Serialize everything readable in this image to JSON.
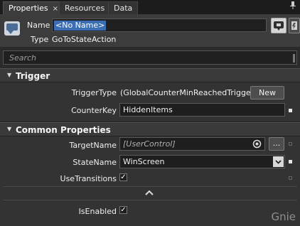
{
  "tabs": [
    {
      "label": "Properties",
      "close": "×"
    },
    {
      "label": "Resources"
    },
    {
      "label": "Data"
    }
  ],
  "header": {
    "name_label": "Name",
    "name_value": "<No Name>",
    "type_label": "Type",
    "type_value": "GoToStateAction"
  },
  "search": {
    "placeholder": "Search"
  },
  "trigger": {
    "title": "Trigger",
    "trigger_type_label": "TriggerType",
    "trigger_type_value": "(GlobalCounterMinReachedTrigger)",
    "new_label": "New",
    "counter_key_label": "CounterKey",
    "counter_key_value": "HiddenItems"
  },
  "common": {
    "title": "Common Properties",
    "target_name_label": "TargetName",
    "target_name_value": "[UserControl]",
    "browse_label": "...",
    "state_name_label": "StateName",
    "state_name_value": "WinScreen",
    "use_transitions_label": "UseTransitions",
    "use_transitions_checked": "✓",
    "is_enabled_label": "IsEnabled",
    "is_enabled_checked": "✓"
  },
  "watermark": "Gnie"
}
